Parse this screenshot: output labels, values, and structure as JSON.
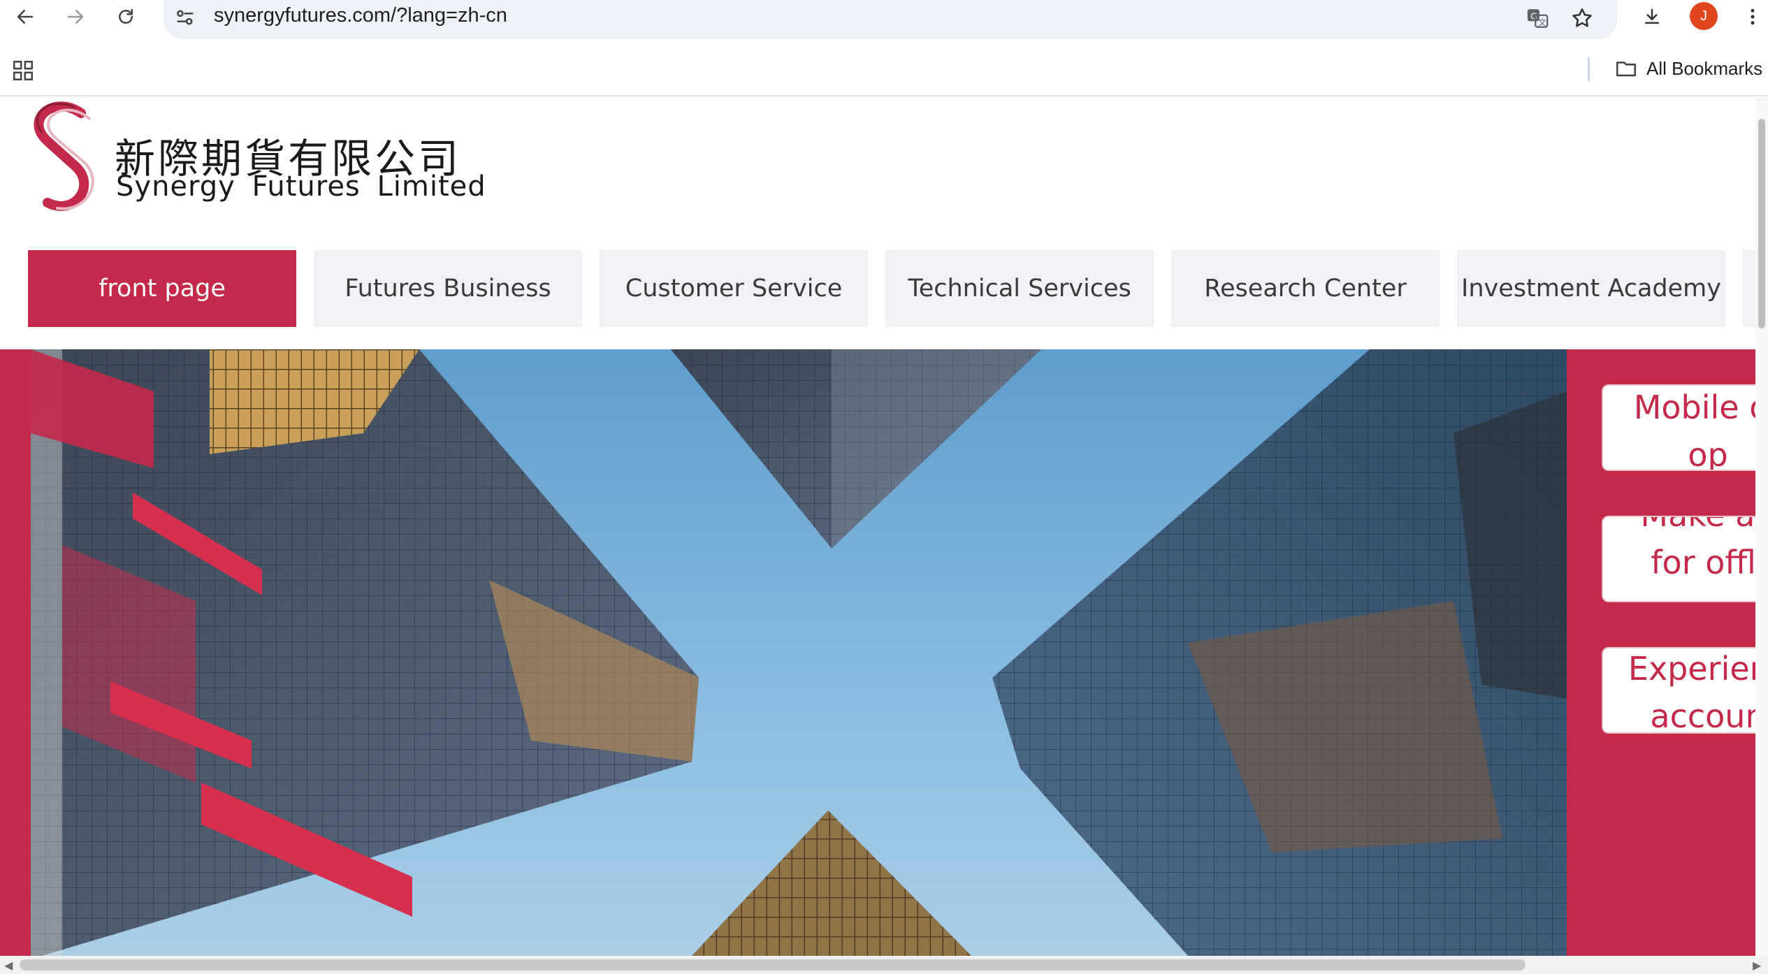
{
  "browser": {
    "url": "synergyfutures.com/?lang=zh-cn",
    "bookmarks_label": "All Bookmarks",
    "profile_initial": "J",
    "profile_color": "#e0451e",
    "icons": [
      "back-arrow-icon",
      "forward-arrow-icon",
      "reload-icon",
      "site-settings-icon",
      "translate-icon",
      "star-icon",
      "download-icon",
      "more-vert-icon",
      "apps-grid-icon",
      "folder-icon"
    ]
  },
  "site": {
    "brand_cn": "新際期貨有限公司",
    "brand_en": "Synergy Futures Limited",
    "accent_color": "#c4294a",
    "nav": [
      {
        "label": "front page",
        "active": true
      },
      {
        "label": "Futures Business",
        "active": false
      },
      {
        "label": "Customer Service",
        "active": false
      },
      {
        "label": "Technical Services",
        "active": false
      },
      {
        "label": "Research Center",
        "active": false
      },
      {
        "label": "Investment Academy",
        "active": false
      }
    ],
    "side_cards": [
      {
        "line1": "Mobile or",
        "line2": "op"
      },
      {
        "line1": "Make an",
        "line2": "for offli"
      },
      {
        "line1": "Experienc",
        "line2": "accoun"
      }
    ]
  }
}
